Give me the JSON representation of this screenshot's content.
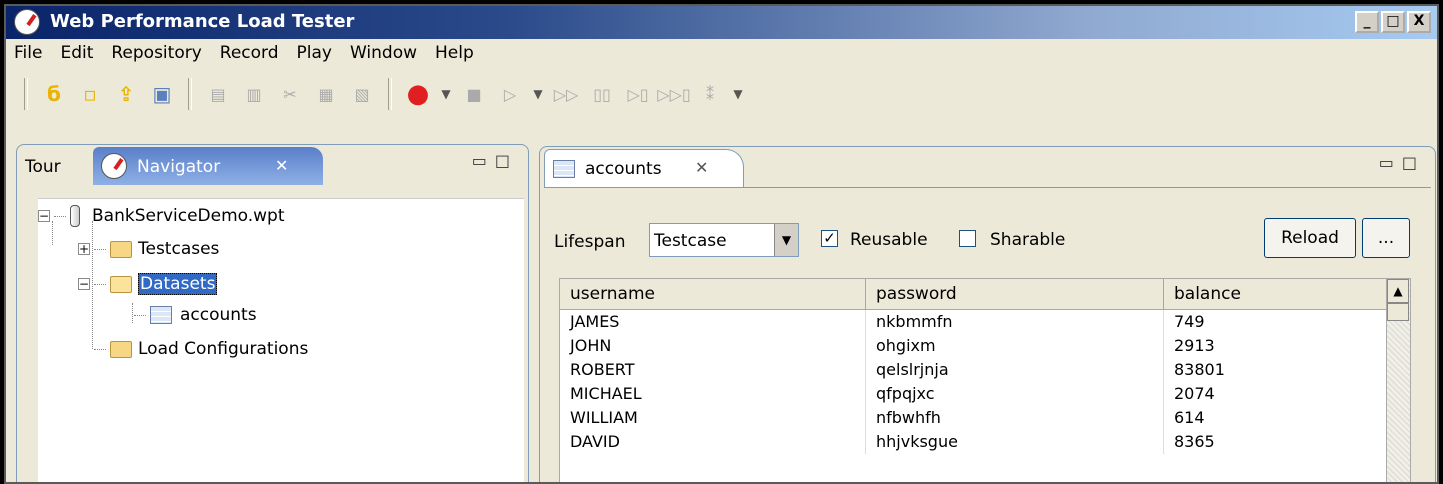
{
  "window": {
    "title": "Web Performance Load Tester",
    "controls": [
      "_",
      "□",
      "X"
    ]
  },
  "menu": [
    "File",
    "Edit",
    "Repository",
    "Record",
    "Play",
    "Window",
    "Help"
  ],
  "toolbar": {
    "icons": [
      "new-icon",
      "open-icon",
      "import-icon",
      "save-icon",
      "copy-icon",
      "compare-icon",
      "cut-icon",
      "copy-doc-icon",
      "paste-icon",
      "record-icon",
      "stop-icon",
      "play-icon",
      "fast-forward-icon",
      "pause-icon",
      "step-icon",
      "step-multi-icon",
      "replay-icon"
    ]
  },
  "left_panel": {
    "tab_tour": "Tour",
    "tab_navigator": "Navigator",
    "tree": {
      "root": "BankServiceDemo.wpt",
      "testcases": "Testcases",
      "datasets": "Datasets",
      "accounts": "accounts",
      "load_configurations": "Load Configurations"
    }
  },
  "right_panel": {
    "tab": "accounts",
    "lifespan_label": "Lifespan",
    "lifespan_value": "Testcase",
    "reusable_label": "Reusable",
    "reusable_checked": true,
    "sharable_label": "Sharable",
    "sharable_checked": false,
    "reload_label": "Reload",
    "more_label": "...",
    "columns": [
      "username",
      "password",
      "balance"
    ],
    "rows": [
      [
        "JAMES",
        "nkbmmfn",
        "749"
      ],
      [
        "JOHN",
        "ohgixm",
        "2913"
      ],
      [
        "ROBERT",
        "qelslrjnja",
        "83801"
      ],
      [
        "MICHAEL",
        "qfpqjxc",
        "2074"
      ],
      [
        "WILLIAM",
        "nfbwhfh",
        "614"
      ],
      [
        "DAVID",
        "hhjvksgue",
        "8365"
      ]
    ]
  }
}
